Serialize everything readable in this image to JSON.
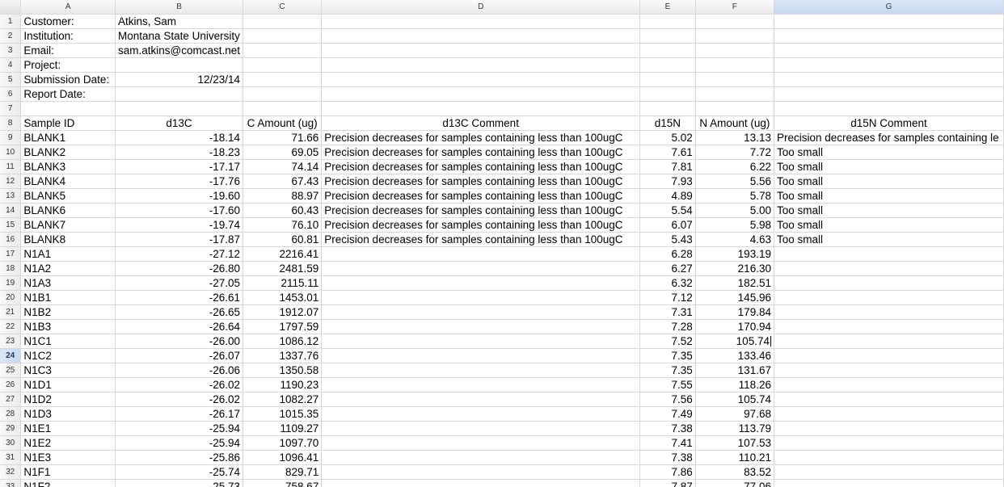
{
  "columns": [
    "A",
    "B",
    "C",
    "D",
    "E",
    "F",
    "G"
  ],
  "selected_column": "G",
  "selected_row": 24,
  "rows": [
    {
      "n": 1,
      "cells": [
        "Customer:",
        "Atkins, Sam",
        "",
        "",
        "",
        "",
        ""
      ]
    },
    {
      "n": 2,
      "cells": [
        "Institution:",
        "Montana State University",
        "",
        "",
        "",
        "",
        ""
      ]
    },
    {
      "n": 3,
      "cells": [
        "Email:",
        "sam.atkins@comcast.net",
        "",
        "",
        "",
        "",
        ""
      ]
    },
    {
      "n": 4,
      "cells": [
        "Project:",
        "",
        "",
        "",
        "",
        "",
        ""
      ]
    },
    {
      "n": 5,
      "cells": [
        "Submission Date:",
        "12/23/14",
        "",
        "",
        "",
        "",
        ""
      ]
    },
    {
      "n": 6,
      "cells": [
        "Report Date:",
        "",
        "",
        "",
        "",
        "",
        ""
      ]
    },
    {
      "n": 7,
      "cells": [
        "",
        "",
        "",
        "",
        "",
        "",
        ""
      ]
    },
    {
      "n": 8,
      "cells": [
        "Sample ID",
        "d13C",
        "C Amount (ug)",
        "d13C Comment",
        "d15N",
        "N Amount (ug)",
        "d15N Comment"
      ]
    },
    {
      "n": 9,
      "cells": [
        "BLANK1",
        "-18.14",
        "71.66",
        "Precision decreases for samples containing less than 100ugC",
        "5.02",
        "13.13",
        "Precision decreases for samples containing le"
      ]
    },
    {
      "n": 10,
      "cells": [
        "BLANK2",
        "-18.23",
        "69.05",
        "Precision decreases for samples containing less than 100ugC",
        "7.61",
        "7.72",
        "Too small"
      ]
    },
    {
      "n": 11,
      "cells": [
        "BLANK3",
        "-17.17",
        "74.14",
        "Precision decreases for samples containing less than 100ugC",
        "7.81",
        "6.22",
        "Too small"
      ]
    },
    {
      "n": 12,
      "cells": [
        "BLANK4",
        "-17.76",
        "67.43",
        "Precision decreases for samples containing less than 100ugC",
        "7.93",
        "5.56",
        "Too small"
      ]
    },
    {
      "n": 13,
      "cells": [
        "BLANK5",
        "-19.60",
        "88.97",
        "Precision decreases for samples containing less than 100ugC",
        "4.89",
        "5.78",
        "Too small"
      ]
    },
    {
      "n": 14,
      "cells": [
        "BLANK6",
        "-17.60",
        "60.43",
        "Precision decreases for samples containing less than 100ugC",
        "5.54",
        "5.00",
        "Too small"
      ]
    },
    {
      "n": 15,
      "cells": [
        "BLANK7",
        "-19.74",
        "76.10",
        "Precision decreases for samples containing less than 100ugC",
        "6.07",
        "5.98",
        "Too small"
      ]
    },
    {
      "n": 16,
      "cells": [
        "BLANK8",
        "-17.87",
        "60.81",
        "Precision decreases for samples containing less than 100ugC",
        "5.43",
        "4.63",
        "Too small"
      ]
    },
    {
      "n": 17,
      "cells": [
        "N1A1",
        "-27.12",
        "2216.41",
        "",
        "6.28",
        "193.19",
        ""
      ]
    },
    {
      "n": 18,
      "cells": [
        "N1A2",
        "-26.80",
        "2481.59",
        "",
        "6.27",
        "216.30",
        ""
      ]
    },
    {
      "n": 19,
      "cells": [
        "N1A3",
        "-27.05",
        "2115.11",
        "",
        "6.32",
        "182.51",
        ""
      ]
    },
    {
      "n": 20,
      "cells": [
        "N1B1",
        "-26.61",
        "1453.01",
        "",
        "7.12",
        "145.96",
        ""
      ]
    },
    {
      "n": 21,
      "cells": [
        "N1B2",
        "-26.65",
        "1912.07",
        "",
        "7.31",
        "179.84",
        ""
      ]
    },
    {
      "n": 22,
      "cells": [
        "N1B3",
        "-26.64",
        "1797.59",
        "",
        "7.28",
        "170.94",
        ""
      ]
    },
    {
      "n": 23,
      "cells": [
        "N1C1",
        "-26.00",
        "1086.12",
        "",
        "7.52",
        "105.74",
        ""
      ]
    },
    {
      "n": 24,
      "cells": [
        "N1C2",
        "-26.07",
        "1337.76",
        "",
        "7.35",
        "133.46",
        ""
      ]
    },
    {
      "n": 25,
      "cells": [
        "N1C3",
        "-26.06",
        "1350.58",
        "",
        "7.35",
        "131.67",
        ""
      ]
    },
    {
      "n": 26,
      "cells": [
        "N1D1",
        "-26.02",
        "1190.23",
        "",
        "7.55",
        "118.26",
        ""
      ]
    },
    {
      "n": 27,
      "cells": [
        "N1D2",
        "-26.02",
        "1082.27",
        "",
        "7.56",
        "105.74",
        ""
      ]
    },
    {
      "n": 28,
      "cells": [
        "N1D3",
        "-26.17",
        "1015.35",
        "",
        "7.49",
        "97.68",
        ""
      ]
    },
    {
      "n": 29,
      "cells": [
        "N1E1",
        "-25.94",
        "1109.27",
        "",
        "7.38",
        "113.79",
        ""
      ]
    },
    {
      "n": 30,
      "cells": [
        "N1E2",
        "-25.94",
        "1097.70",
        "",
        "7.41",
        "107.53",
        ""
      ]
    },
    {
      "n": 31,
      "cells": [
        "N1E3",
        "-25.86",
        "1096.41",
        "",
        "7.38",
        "110.21",
        ""
      ]
    },
    {
      "n": 32,
      "cells": [
        "N1F1",
        "-25.74",
        "829.71",
        "",
        "7.86",
        "83.52",
        ""
      ]
    },
    {
      "n": 33,
      "cells": [
        "N1F2",
        "-25.73",
        "758.67",
        "",
        "7.87",
        "77.06",
        ""
      ]
    }
  ]
}
